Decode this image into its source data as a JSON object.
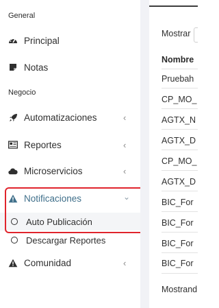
{
  "sidebar": {
    "sections": [
      {
        "title": "General"
      },
      {
        "title": "Negocio"
      }
    ],
    "items": [
      {
        "label": "Principal",
        "icon": "dashboard-icon"
      },
      {
        "label": "Notas",
        "icon": "note-icon"
      },
      {
        "label": "Automatizaciones",
        "icon": "rocket-icon",
        "chevron": "‹"
      },
      {
        "label": "Reportes",
        "icon": "newspaper-icon",
        "chevron": "‹"
      },
      {
        "label": "Microservicios",
        "icon": "cloud-icon",
        "chevron": "‹"
      },
      {
        "label": "Notificaciones",
        "icon": "warning-icon",
        "chevron": "⌄",
        "expanded": true
      },
      {
        "label": "Comunidad",
        "icon": "warning-icon",
        "chevron": "‹"
      }
    ],
    "sub_items": [
      {
        "label": "Auto Publicación",
        "icon": "circle-icon"
      },
      {
        "label": "Descargar Reportes",
        "icon": "circle-icon"
      }
    ]
  },
  "main": {
    "show_label": "Mostrar",
    "column_header": "Nombre",
    "rows": [
      "Pruebah",
      "CP_MO_",
      "AGTX_N",
      "AGTX_D",
      "CP_MO_",
      "AGTX_D",
      "BIC_For",
      "BIC_For",
      "BIC_For",
      "BIC_For"
    ],
    "footer": "Mostrand"
  },
  "colors": {
    "highlight_border": "#e0242c",
    "active_text": "#3f6f8a",
    "gutter": "#f1f2f6"
  }
}
